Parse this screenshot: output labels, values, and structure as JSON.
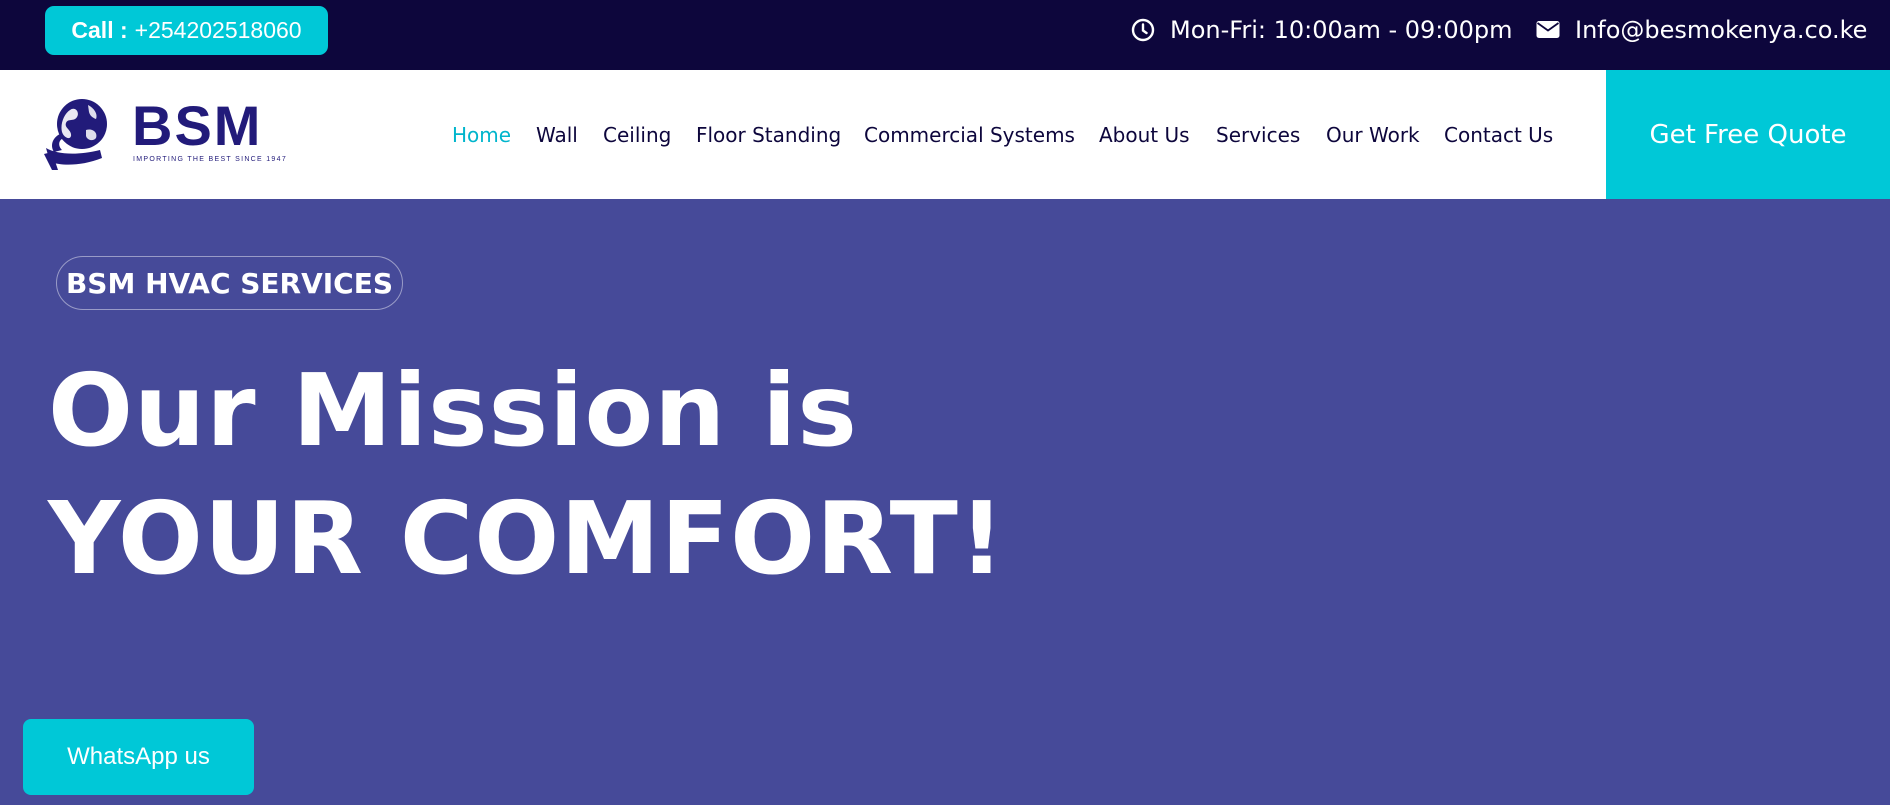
{
  "topbar": {
    "call_label": "Call :",
    "call_number": "+254202518060",
    "hours": "Mon-Fri: 10:00am - 09:00pm",
    "email": "Info@besmokenya.co.ke",
    "hours_icon": "clock-icon",
    "email_icon": "envelope-icon"
  },
  "logo": {
    "text": "BSM",
    "tagline": "IMPORTING THE BEST SINCE 1947"
  },
  "nav": {
    "items": [
      {
        "label": "Home",
        "active": true
      },
      {
        "label": "Wall"
      },
      {
        "label": "Ceiling"
      },
      {
        "label": "Floor Standing"
      },
      {
        "label": "Commercial Systems"
      },
      {
        "label": "About Us"
      },
      {
        "label": "Services"
      },
      {
        "label": "Our Work"
      },
      {
        "label": "Contact Us"
      }
    ]
  },
  "cta": {
    "label": "Get Free Quote"
  },
  "hero": {
    "badge": "BSM HVAC SERVICES",
    "line1": "Our Mission is",
    "line2": "YOUR COMFORT!"
  },
  "whatsapp": {
    "label": "WhatsApp us"
  },
  "colors": {
    "topbar_bg": "#0d063c",
    "accent": "#00c8d7",
    "hero_bg": "#464a99",
    "brand": "#221b7a"
  }
}
